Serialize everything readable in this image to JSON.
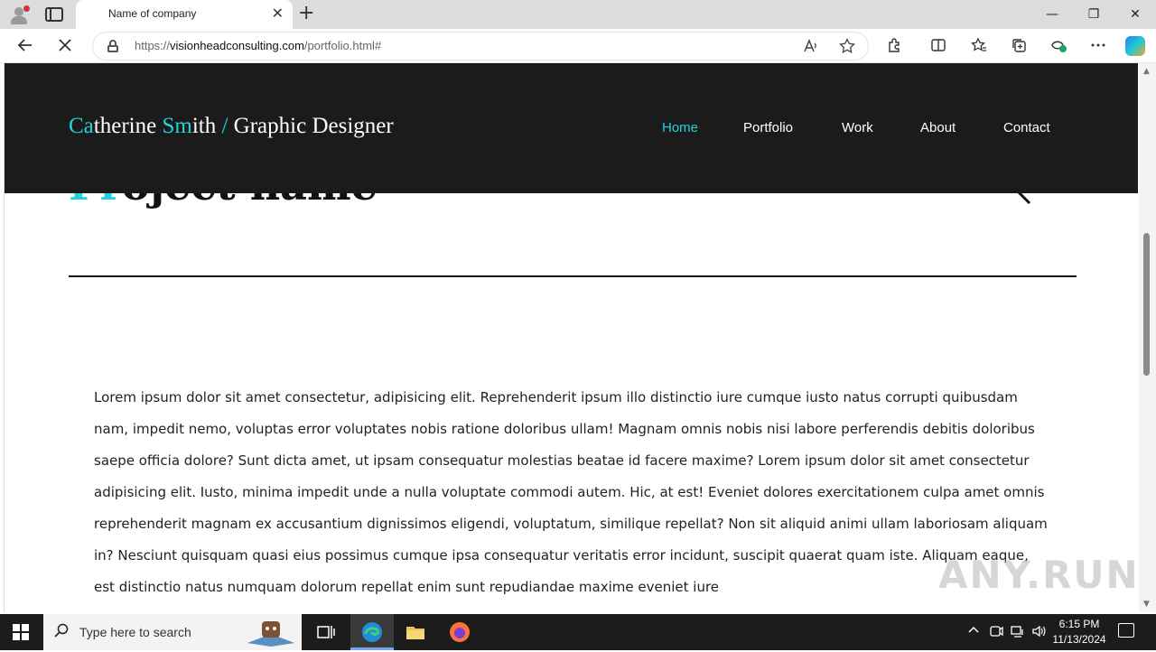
{
  "browser": {
    "tab_title": "Name of company",
    "tab_close": "✕",
    "new_tab": "+",
    "url_prefix": "https://",
    "url_host": "visionheadconsulting.com",
    "url_path": "/portfolio.html#",
    "window_controls": {
      "minimize": "—",
      "restore": "❐",
      "close": "✕"
    }
  },
  "site": {
    "brand": {
      "first_accent": "Ca",
      "first_rest": "therine ",
      "last_accent": "Sm",
      "last_rest": "ith",
      "slash": " /",
      "role": " Graphic Designer"
    },
    "menu": [
      {
        "label": "Home",
        "active": true
      },
      {
        "label": "Portfolio",
        "active": false
      },
      {
        "label": "Work",
        "active": false
      },
      {
        "label": "About",
        "active": false
      },
      {
        "label": "Contact",
        "active": false
      }
    ],
    "project_title": {
      "accent": "Pr",
      "rest": "oject name"
    },
    "body_text": "Lorem ipsum dolor sit amet consectetur, adipisicing elit. Reprehenderit ipsum illo distinctio iure cumque iusto natus corrupti quibusdam nam, impedit nemo, voluptas error voluptates nobis ratione doloribus ullam! Magnam omnis nobis nisi labore perferendis debitis doloribus saepe officia dolore? Sunt dicta amet, ut ipsam consequatur molestias beatae id facere maxime? Lorem ipsum dolor sit amet consectetur adipisicing elit. Iusto, minima impedit unde a nulla voluptate commodi autem. Hic, at est! Eveniet dolores exercitationem culpa amet omnis reprehenderit magnam ex accusantium dignissimos eligendi, voluptatum, similique repellat? Non sit aliquid animi ullam laboriosam aliquam in? Nesciunt quisquam quasi eius possimus cumque ipsa consequatur veritatis error incidunt, suscipit quaerat quam iste. Aliquam eaque, est distinctio natus numquam dolorum repellat enim sunt repudiandae maxime eveniet iure",
    "watermark": "ANY.RUN",
    "accent_color": "#22d3d8",
    "header_bg": "#1b1b1b"
  },
  "taskbar": {
    "search_placeholder": "Type here to search",
    "time": "6:15 PM",
    "date": "11/13/2024"
  }
}
